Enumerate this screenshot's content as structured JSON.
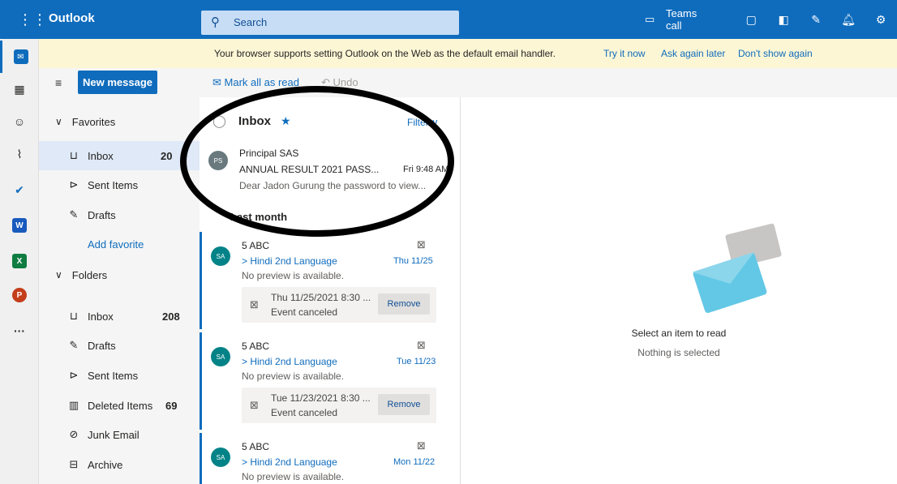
{
  "header": {
    "app_name": "Outlook",
    "search_placeholder": "Search",
    "teams_label": "Teams call"
  },
  "banner": {
    "text": "Your browser supports setting Outlook on the Web as the default email handler.",
    "links": [
      "Try it now",
      "Ask again later",
      "Don't show again"
    ]
  },
  "command_bar": {
    "new_message": "New message",
    "mark_all_read": "Mark all as read",
    "undo": "Undo"
  },
  "nav": {
    "favorites_label": "Favorites",
    "favorites": [
      {
        "label": "Inbox",
        "count": "20"
      },
      {
        "label": "Sent Items",
        "count": ""
      },
      {
        "label": "Drafts",
        "count": ""
      }
    ],
    "add_favorite": "Add favorite",
    "folders_label": "Folders",
    "folders": [
      {
        "label": "Inbox",
        "count": "208"
      },
      {
        "label": "Drafts",
        "count": ""
      },
      {
        "label": "Sent Items",
        "count": ""
      },
      {
        "label": "Deleted Items",
        "count": "69"
      },
      {
        "label": "Junk Email",
        "count": ""
      },
      {
        "label": "Archive",
        "count": ""
      }
    ]
  },
  "message_list": {
    "title": "Inbox",
    "filter_label": "Filter",
    "section_label": "Last month",
    "messages": [
      {
        "avatar": "PS",
        "sender": "Principal SAS",
        "subject": "ANNUAL RESULT 2021 PASS...",
        "date": "Fri 9:48 AM",
        "preview": "Dear Jadon Gurung the password to view..."
      },
      {
        "avatar": "SA",
        "sender": "5 ABC",
        "subject": "> Hindi 2nd Language",
        "date": "Thu 11/25",
        "preview": "No preview is available.",
        "event_time": "Thu 11/25/2021 8:30 ...",
        "event_status": "Event canceled",
        "action": "Remove"
      },
      {
        "avatar": "SA",
        "sender": "5 ABC",
        "subject": "> Hindi 2nd Language",
        "date": "Tue 11/23",
        "preview": "No preview is available.",
        "event_time": "Tue 11/23/2021 8:30 ...",
        "event_status": "Event canceled",
        "action": "Remove"
      },
      {
        "avatar": "SA",
        "sender": "5 ABC",
        "subject": "> Hindi 2nd Language",
        "date": "Mon 11/22",
        "preview": "No preview is available."
      }
    ]
  },
  "reading_pane": {
    "title": "Select an item to read",
    "subtitle": "Nothing is selected"
  },
  "colors": {
    "brand": "#0f6cbd",
    "avatar_ps": "#69797e",
    "avatar_sa": "#038387",
    "banner": "#fcf6d5"
  }
}
